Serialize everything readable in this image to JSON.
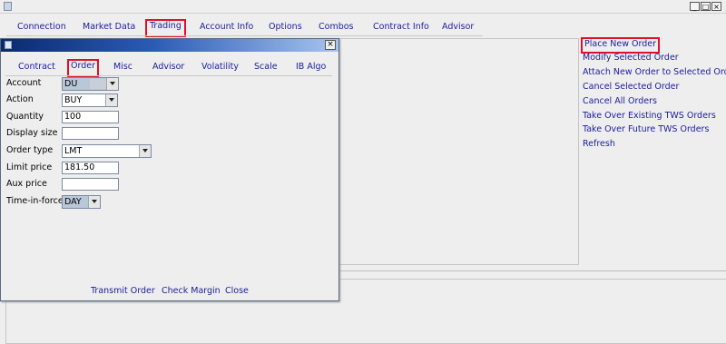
{
  "window": {
    "minimize_label": "_",
    "maximize_label": "□",
    "close_label": "×"
  },
  "menu": {
    "tabs": [
      {
        "label": "Connection"
      },
      {
        "label": "Market Data"
      },
      {
        "label": "Trading"
      },
      {
        "label": "Account Info"
      },
      {
        "label": "Options"
      },
      {
        "label": "Combos"
      },
      {
        "label": "Contract Info"
      },
      {
        "label": "Advisor"
      }
    ],
    "active": "Trading"
  },
  "actions": {
    "items": [
      {
        "label": "Place New Order"
      },
      {
        "label": "Modify Selected Order"
      },
      {
        "label": "Attach New Order to Selected Order"
      },
      {
        "label": "Cancel Selected Order"
      },
      {
        "label": "Cancel All Orders"
      },
      {
        "label": "Take Over Existing TWS Orders"
      },
      {
        "label": "Take Over Future TWS Orders"
      },
      {
        "label": "Refresh"
      }
    ],
    "highlighted": "Place New Order"
  },
  "dialog": {
    "close_label": "×",
    "tabs": [
      {
        "label": "Contract"
      },
      {
        "label": "Order"
      },
      {
        "label": "Misc"
      },
      {
        "label": "Advisor"
      },
      {
        "label": "Volatility"
      },
      {
        "label": "Scale"
      },
      {
        "label": "IB Algo"
      }
    ],
    "active_tab": "Order",
    "form": {
      "account": {
        "label": "Account",
        "value": "DU"
      },
      "action": {
        "label": "Action",
        "value": "BUY"
      },
      "quantity": {
        "label": "Quantity",
        "value": "100"
      },
      "display_size": {
        "label": "Display size",
        "value": ""
      },
      "order_type": {
        "label": "Order type",
        "value": "LMT"
      },
      "limit_price": {
        "label": "Limit price",
        "value": "181.50"
      },
      "aux_price": {
        "label": "Aux price",
        "value": ""
      },
      "time_in_force": {
        "label": "Time-in-force",
        "value": "DAY"
      }
    },
    "buttons": {
      "transmit": "Transmit Order",
      "check_margin": "Check Margin",
      "close": "Close"
    }
  },
  "colors": {
    "link": "#1c1c9c",
    "highlight": "#e0102a",
    "title_gradient_start": "#0a2a6e",
    "title_gradient_end": "#a8c4ee"
  }
}
